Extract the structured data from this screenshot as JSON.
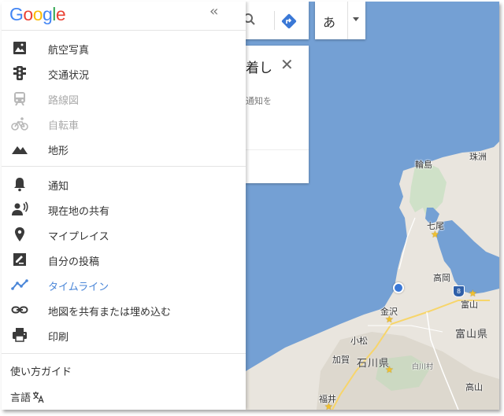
{
  "logo": {
    "text": "Google",
    "letters": [
      "G",
      "o",
      "o",
      "g",
      "l",
      "e"
    ],
    "colors": [
      "#4285f4",
      "#ea4335",
      "#fbbc05",
      "#4285f4",
      "#34a853",
      "#ea4335"
    ]
  },
  "collapse_label": "«",
  "menu": {
    "group1": [
      {
        "icon": "satellite-icon",
        "label": "航空写真",
        "state": "normal"
      },
      {
        "icon": "traffic-light-icon",
        "label": "交通状況",
        "state": "normal"
      },
      {
        "icon": "transit-icon",
        "label": "路線図",
        "state": "disabled"
      },
      {
        "icon": "bicycle-icon",
        "label": "自転車",
        "state": "disabled"
      },
      {
        "icon": "terrain-icon",
        "label": "地形",
        "state": "normal"
      }
    ],
    "group2": [
      {
        "icon": "bell-icon",
        "label": "通知",
        "state": "normal"
      },
      {
        "icon": "location-sharing-icon",
        "label": "現在地の共有",
        "state": "normal"
      },
      {
        "icon": "place-pin-icon",
        "label": "マイプレイス",
        "state": "normal"
      },
      {
        "icon": "contribution-icon",
        "label": "自分の投稿",
        "state": "normal"
      },
      {
        "icon": "timeline-icon",
        "label": "タイムライン",
        "state": "active"
      },
      {
        "icon": "link-icon",
        "label": "地図を共有または埋め込む",
        "state": "normal"
      },
      {
        "icon": "print-icon",
        "label": "印刷",
        "state": "normal"
      }
    ],
    "guide": "使い方ガイド",
    "language": "言語"
  },
  "lang_button": {
    "char": "あ"
  },
  "card": {
    "title": "着し",
    "close": "✕",
    "body": "通知を"
  },
  "map": {
    "cities": [
      "珠洲",
      "輪島",
      "七尾",
      "高岡",
      "富山",
      "金沢",
      "小松",
      "加賀",
      "白川村",
      "福井",
      "高山"
    ],
    "prefectures": [
      "富山県",
      "石川県"
    ],
    "route_shield": "8"
  },
  "colors": {
    "active": "#4a86d8",
    "sea": "#74a0d4",
    "land": "#e9e5de"
  }
}
